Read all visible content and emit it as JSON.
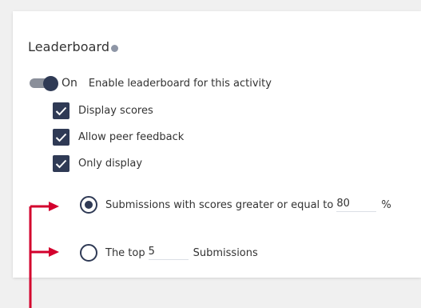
{
  "section": {
    "title": "Leaderboard",
    "info_icon": "info-icon"
  },
  "toggle": {
    "state_label": "On",
    "enabled": true,
    "description": "Enable leaderboard for this activity"
  },
  "options": [
    {
      "label": "Display scores",
      "checked": true
    },
    {
      "label": "Allow peer feedback",
      "checked": true
    },
    {
      "label": "Only display",
      "checked": true
    }
  ],
  "radios": [
    {
      "label": "Submissions with scores greater or equal to",
      "value": "80",
      "suffix": "%",
      "selected": true
    },
    {
      "prefix": "The top",
      "value": "5",
      "suffix": "Submissions",
      "selected": false
    }
  ],
  "colors": {
    "primary": "#2f3a55",
    "annotation_arrow": "#d3002d"
  }
}
